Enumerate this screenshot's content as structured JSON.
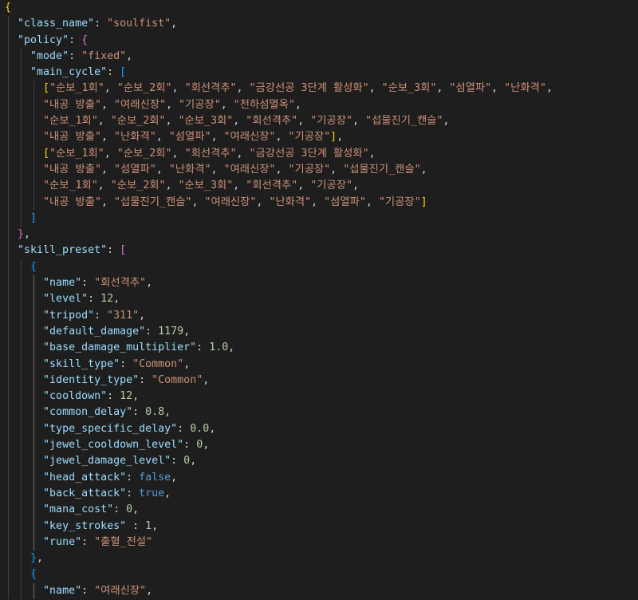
{
  "editor": {
    "theme_colors": {
      "background": "#1e1e1e",
      "key": "#9cdcfe",
      "string": "#ce9178",
      "number": "#b5cea8",
      "boolean": "#569cd6",
      "punctuation": "#d4d4d4",
      "bracket_level_1": "#ffd700",
      "bracket_level_2": "#da70d6",
      "bracket_level_3": "#179fff"
    },
    "lines": [
      [
        {
          "t": "{",
          "c": "b1"
        }
      ],
      [
        {
          "t": "\"class_name\"",
          "c": "k"
        },
        {
          "t": ": ",
          "c": "p"
        },
        {
          "t": "\"soulfist\"",
          "c": "s"
        },
        {
          "t": ",",
          "c": "p"
        }
      ],
      [
        {
          "t": "\"policy\"",
          "c": "k"
        },
        {
          "t": ": ",
          "c": "p"
        },
        {
          "t": "{",
          "c": "b2"
        }
      ],
      [
        {
          "t": "\"mode\"",
          "c": "k"
        },
        {
          "t": ": ",
          "c": "p"
        },
        {
          "t": "\"fixed\"",
          "c": "s"
        },
        {
          "t": ",",
          "c": "p"
        }
      ],
      [
        {
          "t": "\"main_cycle\"",
          "c": "k"
        },
        {
          "t": ": ",
          "c": "p"
        },
        {
          "t": "[",
          "c": "b3"
        }
      ],
      [
        {
          "t": "[",
          "c": "b1"
        },
        {
          "t": "\"순보_1회\"",
          "c": "s"
        },
        {
          "t": ", ",
          "c": "p"
        },
        {
          "t": "\"순보_2회\"",
          "c": "s"
        },
        {
          "t": ", ",
          "c": "p"
        },
        {
          "t": "\"회선격추\"",
          "c": "s"
        },
        {
          "t": ", ",
          "c": "p"
        },
        {
          "t": "\"금강선공 3단계 활성화\"",
          "c": "s"
        },
        {
          "t": ", ",
          "c": "p"
        },
        {
          "t": "\"순보_3회\"",
          "c": "s"
        },
        {
          "t": ", ",
          "c": "p"
        },
        {
          "t": "\"섬열파\"",
          "c": "s"
        },
        {
          "t": ", ",
          "c": "p"
        },
        {
          "t": "\"난화격\"",
          "c": "s"
        },
        {
          "t": ",",
          "c": "p"
        }
      ],
      [
        {
          "t": "\"내공 방출\"",
          "c": "s"
        },
        {
          "t": ", ",
          "c": "p"
        },
        {
          "t": "\"여래신장\"",
          "c": "s"
        },
        {
          "t": ", ",
          "c": "p"
        },
        {
          "t": "\"기공장\"",
          "c": "s"
        },
        {
          "t": ", ",
          "c": "p"
        },
        {
          "t": "\"천하섬멸옥\"",
          "c": "s"
        },
        {
          "t": ",",
          "c": "p"
        }
      ],
      [
        {
          "t": "\"순보_1회\"",
          "c": "s"
        },
        {
          "t": ", ",
          "c": "p"
        },
        {
          "t": "\"순보_2회\"",
          "c": "s"
        },
        {
          "t": ", ",
          "c": "p"
        },
        {
          "t": "\"순보_3회\"",
          "c": "s"
        },
        {
          "t": ", ",
          "c": "p"
        },
        {
          "t": "\"회선격추\"",
          "c": "s"
        },
        {
          "t": ", ",
          "c": "p"
        },
        {
          "t": "\"기공장\"",
          "c": "s"
        },
        {
          "t": ", ",
          "c": "p"
        },
        {
          "t": "\"섭물진기_캔슬\"",
          "c": "s"
        },
        {
          "t": ",",
          "c": "p"
        }
      ],
      [
        {
          "t": "\"내공 방출\"",
          "c": "s"
        },
        {
          "t": ", ",
          "c": "p"
        },
        {
          "t": "\"난화격\"",
          "c": "s"
        },
        {
          "t": ", ",
          "c": "p"
        },
        {
          "t": "\"섬열파\"",
          "c": "s"
        },
        {
          "t": ", ",
          "c": "p"
        },
        {
          "t": "\"여래신장\"",
          "c": "s"
        },
        {
          "t": ", ",
          "c": "p"
        },
        {
          "t": "\"기공장\"",
          "c": "s"
        },
        {
          "t": "]",
          "c": "b1"
        },
        {
          "t": ",",
          "c": "p"
        }
      ],
      [
        {
          "t": "[",
          "c": "b1"
        },
        {
          "t": "\"순보_1회\"",
          "c": "s"
        },
        {
          "t": ", ",
          "c": "p"
        },
        {
          "t": "\"순보_2회\"",
          "c": "s"
        },
        {
          "t": ", ",
          "c": "p"
        },
        {
          "t": "\"회선격추\"",
          "c": "s"
        },
        {
          "t": ", ",
          "c": "p"
        },
        {
          "t": "\"금강선공 3단계 활성화\"",
          "c": "s"
        },
        {
          "t": ",",
          "c": "p"
        }
      ],
      [
        {
          "t": "\"내공 방출\"",
          "c": "s"
        },
        {
          "t": ", ",
          "c": "p"
        },
        {
          "t": "\"섬열파\"",
          "c": "s"
        },
        {
          "t": ", ",
          "c": "p"
        },
        {
          "t": "\"난화격\"",
          "c": "s"
        },
        {
          "t": ", ",
          "c": "p"
        },
        {
          "t": "\"여래신장\"",
          "c": "s"
        },
        {
          "t": ", ",
          "c": "p"
        },
        {
          "t": "\"기공장\"",
          "c": "s"
        },
        {
          "t": ", ",
          "c": "p"
        },
        {
          "t": "\"섭물진기_캔슬\"",
          "c": "s"
        },
        {
          "t": ",",
          "c": "p"
        }
      ],
      [
        {
          "t": "\"순보_1회\"",
          "c": "s"
        },
        {
          "t": ", ",
          "c": "p"
        },
        {
          "t": "\"순보_2회\"",
          "c": "s"
        },
        {
          "t": ", ",
          "c": "p"
        },
        {
          "t": "\"순보_3회\"",
          "c": "s"
        },
        {
          "t": ", ",
          "c": "p"
        },
        {
          "t": "\"회선격추\"",
          "c": "s"
        },
        {
          "t": ", ",
          "c": "p"
        },
        {
          "t": "\"기공장\"",
          "c": "s"
        },
        {
          "t": ",",
          "c": "p"
        }
      ],
      [
        {
          "t": "\"내공 방출\"",
          "c": "s"
        },
        {
          "t": ", ",
          "c": "p"
        },
        {
          "t": "\"섭물진기_캔슬\"",
          "c": "s"
        },
        {
          "t": ", ",
          "c": "p"
        },
        {
          "t": "\"여래신장\"",
          "c": "s"
        },
        {
          "t": ", ",
          "c": "p"
        },
        {
          "t": "\"난화격\"",
          "c": "s"
        },
        {
          "t": ", ",
          "c": "p"
        },
        {
          "t": "\"섬열파\"",
          "c": "s"
        },
        {
          "t": ", ",
          "c": "p"
        },
        {
          "t": "\"기공장\"",
          "c": "s"
        },
        {
          "t": "]",
          "c": "b1"
        }
      ],
      [
        {
          "t": "]",
          "c": "b3"
        }
      ],
      [
        {
          "t": "}",
          "c": "b2"
        },
        {
          "t": ",",
          "c": "p"
        }
      ],
      [
        {
          "t": "\"skill_preset\"",
          "c": "k"
        },
        {
          "t": ": ",
          "c": "p"
        },
        {
          "t": "[",
          "c": "b2"
        }
      ],
      [
        {
          "t": "{",
          "c": "b3"
        }
      ],
      [
        {
          "t": "\"name\"",
          "c": "k"
        },
        {
          "t": ": ",
          "c": "p"
        },
        {
          "t": "\"회선격추\"",
          "c": "s"
        },
        {
          "t": ",",
          "c": "p"
        }
      ],
      [
        {
          "t": "\"level\"",
          "c": "k"
        },
        {
          "t": ": ",
          "c": "p"
        },
        {
          "t": "12",
          "c": "n"
        },
        {
          "t": ",",
          "c": "p"
        }
      ],
      [
        {
          "t": "\"tripod\"",
          "c": "k"
        },
        {
          "t": ": ",
          "c": "p"
        },
        {
          "t": "\"311\"",
          "c": "s"
        },
        {
          "t": ",",
          "c": "p"
        }
      ],
      [
        {
          "t": "\"default_damage\"",
          "c": "k"
        },
        {
          "t": ": ",
          "c": "p"
        },
        {
          "t": "1179",
          "c": "n"
        },
        {
          "t": ",",
          "c": "p"
        }
      ],
      [
        {
          "t": "\"base_damage_multiplier\"",
          "c": "k"
        },
        {
          "t": ": ",
          "c": "p"
        },
        {
          "t": "1.0",
          "c": "n"
        },
        {
          "t": ",",
          "c": "p"
        }
      ],
      [
        {
          "t": "\"skill_type\"",
          "c": "k"
        },
        {
          "t": ": ",
          "c": "p"
        },
        {
          "t": "\"Common\"",
          "c": "s"
        },
        {
          "t": ",",
          "c": "p"
        }
      ],
      [
        {
          "t": "\"identity_type\"",
          "c": "k"
        },
        {
          "t": ": ",
          "c": "p"
        },
        {
          "t": "\"Common\"",
          "c": "s"
        },
        {
          "t": ",",
          "c": "p"
        }
      ],
      [
        {
          "t": "\"cooldown\"",
          "c": "k"
        },
        {
          "t": ": ",
          "c": "p"
        },
        {
          "t": "12",
          "c": "n"
        },
        {
          "t": ",",
          "c": "p"
        }
      ],
      [
        {
          "t": "\"common_delay\"",
          "c": "k"
        },
        {
          "t": ": ",
          "c": "p"
        },
        {
          "t": "0.8",
          "c": "n"
        },
        {
          "t": ",",
          "c": "p"
        }
      ],
      [
        {
          "t": "\"type_specific_delay\"",
          "c": "k"
        },
        {
          "t": ": ",
          "c": "p"
        },
        {
          "t": "0.0",
          "c": "n"
        },
        {
          "t": ",",
          "c": "p"
        }
      ],
      [
        {
          "t": "\"jewel_cooldown_level\"",
          "c": "k"
        },
        {
          "t": ": ",
          "c": "p"
        },
        {
          "t": "0",
          "c": "n"
        },
        {
          "t": ",",
          "c": "p"
        }
      ],
      [
        {
          "t": "\"jewel_damage_level\"",
          "c": "k"
        },
        {
          "t": ": ",
          "c": "p"
        },
        {
          "t": "0",
          "c": "n"
        },
        {
          "t": ",",
          "c": "p"
        }
      ],
      [
        {
          "t": "\"head_attack\"",
          "c": "k"
        },
        {
          "t": ": ",
          "c": "p"
        },
        {
          "t": "false",
          "c": "b"
        },
        {
          "t": ",",
          "c": "p"
        }
      ],
      [
        {
          "t": "\"back_attack\"",
          "c": "k"
        },
        {
          "t": ": ",
          "c": "p"
        },
        {
          "t": "true",
          "c": "b"
        },
        {
          "t": ",",
          "c": "p"
        }
      ],
      [
        {
          "t": "\"mana_cost\"",
          "c": "k"
        },
        {
          "t": ": ",
          "c": "p"
        },
        {
          "t": "0",
          "c": "n"
        },
        {
          "t": ",",
          "c": "p"
        }
      ],
      [
        {
          "t": "\"key_strokes\"",
          "c": "k"
        },
        {
          "t": " : ",
          "c": "p"
        },
        {
          "t": "1",
          "c": "n"
        },
        {
          "t": ",",
          "c": "p"
        }
      ],
      [
        {
          "t": "\"rune\"",
          "c": "k"
        },
        {
          "t": ": ",
          "c": "p"
        },
        {
          "t": "\"출혈_전설\"",
          "c": "s"
        }
      ],
      [
        {
          "t": "}",
          "c": "b3"
        },
        {
          "t": ",",
          "c": "p"
        }
      ],
      [
        {
          "t": "{",
          "c": "b3"
        }
      ],
      [
        {
          "t": "\"name\"",
          "c": "k"
        },
        {
          "t": ": ",
          "c": "p"
        },
        {
          "t": "\"여래신장\"",
          "c": "s"
        },
        {
          "t": ",",
          "c": "p"
        }
      ]
    ]
  }
}
